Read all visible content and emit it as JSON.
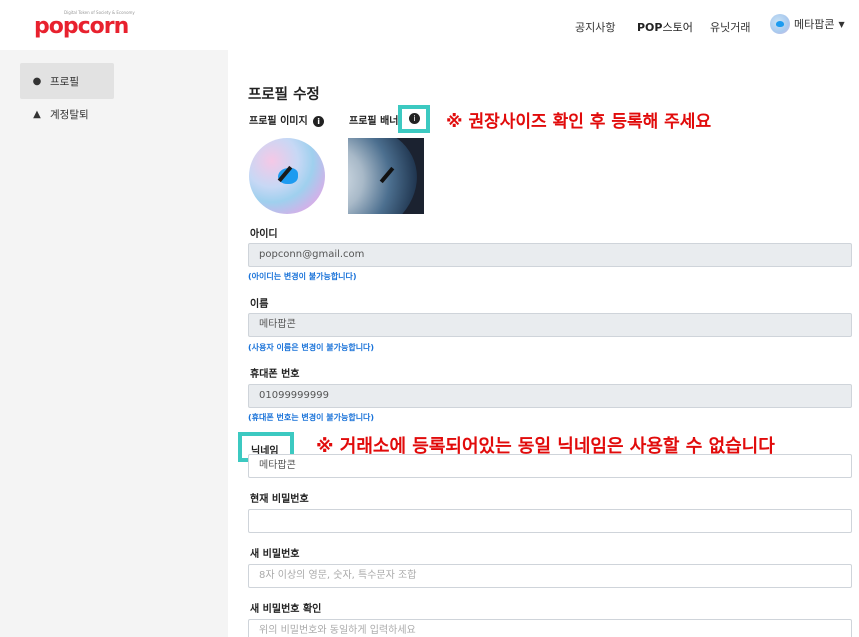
{
  "header": {
    "logo_text": "popcorn",
    "logo_tagline": "Digital Token of Society & Economy",
    "nav": {
      "notice": "공지사항",
      "store_pop": "POP",
      "store_rest": "스토어",
      "used": "유닛거래",
      "user": "메타팝콘"
    }
  },
  "sidebar": {
    "items": [
      {
        "label": "프로필",
        "icon": "user-circle-icon"
      },
      {
        "label": "계정탈퇴",
        "icon": "bell-icon"
      }
    ]
  },
  "main": {
    "title": "프로필 수정",
    "profile_image_label": "프로필 이미지",
    "banner_label": "프로필 배너",
    "annotation_size": "※ 권장사이즈 확인 후 등록해 주세요",
    "annotation_nick": "※ 거래소에 등록되어있는 동일 닉네임은 사용할 수 없습니다",
    "fields": {
      "id": {
        "label": "아이디",
        "value": "popconn@gmail.com",
        "help": "(아이디는 변경이 불가능합니다)"
      },
      "name": {
        "label": "이름",
        "value": "메타팝콘",
        "help": "(사용자 이름은 변경이 불가능합니다)"
      },
      "phone": {
        "label": "휴대폰 번호",
        "value": "01099999999",
        "help": "(휴대폰 번호는 변경이 불가능합니다)"
      },
      "nickname": {
        "label": "닉네임",
        "value": "메타팝콘"
      },
      "current_password": {
        "label": "현재 비밀번호",
        "placeholder": ""
      },
      "new_password": {
        "label": "새 비밀번호",
        "placeholder": "8자 이상의 영문, 숫자, 특수문자 조합"
      },
      "confirm_password": {
        "label": "새 비밀번호 확인",
        "placeholder": "위의 비밀번호와 동일하게 입력하세요"
      }
    }
  },
  "colors": {
    "brand": "#e8212e",
    "annotation": "#e10b0b",
    "highlight": "#3cc9c1",
    "help_text": "#1a73d9"
  }
}
